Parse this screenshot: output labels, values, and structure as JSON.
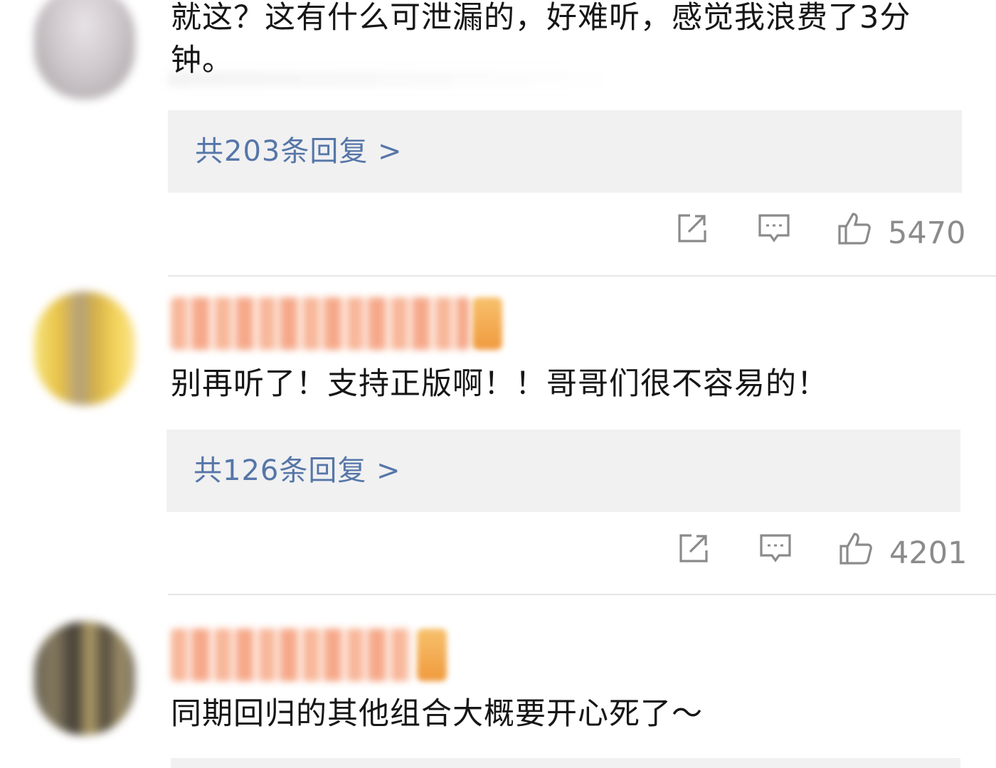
{
  "comments": [
    {
      "text": "就这？这有什么可泄漏的，好难听，感觉我浪费了3分钟。",
      "replies_label": "共203条回复 >",
      "likes": "5470"
    },
    {
      "text": "别再听了！支持正版啊！！哥哥们很不容易的！",
      "replies_label": "共126条回复 >",
      "likes": "4201"
    },
    {
      "text": "同期回归的其他组合大概要开心死了～"
    }
  ],
  "icons": {
    "share": "share-icon",
    "comment": "comment-icon",
    "like": "thumbs-up-icon"
  },
  "colors": {
    "reply_link": "#5676a8",
    "reply_bg": "#f1f1f2",
    "muted": "#8b8b8b"
  }
}
